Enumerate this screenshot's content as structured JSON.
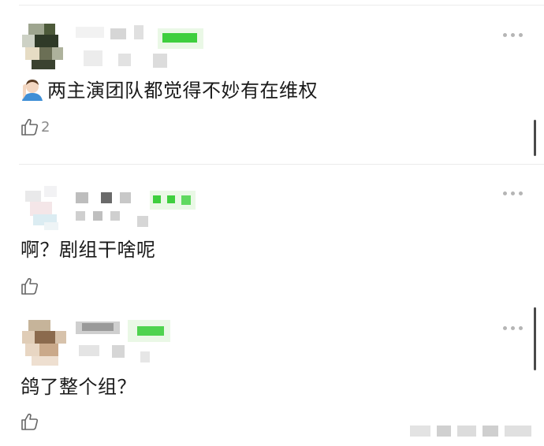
{
  "comments": [
    {
      "text": "两主演团队都觉得不妙有在维权",
      "lead_icon": "person-emoji-icon",
      "likes": "2"
    },
    {
      "text": "啊？剧组干啥呢",
      "likes": ""
    },
    {
      "text": "鸽了整个组？",
      "likes": ""
    }
  ],
  "icons": {
    "like": "thumbs-up-icon",
    "more": "more-dots-icon"
  },
  "colors": {
    "accent_green": "#3ecf3e",
    "text": "#1a1a1a",
    "muted": "#8a8a8a",
    "divider": "#ececec"
  }
}
